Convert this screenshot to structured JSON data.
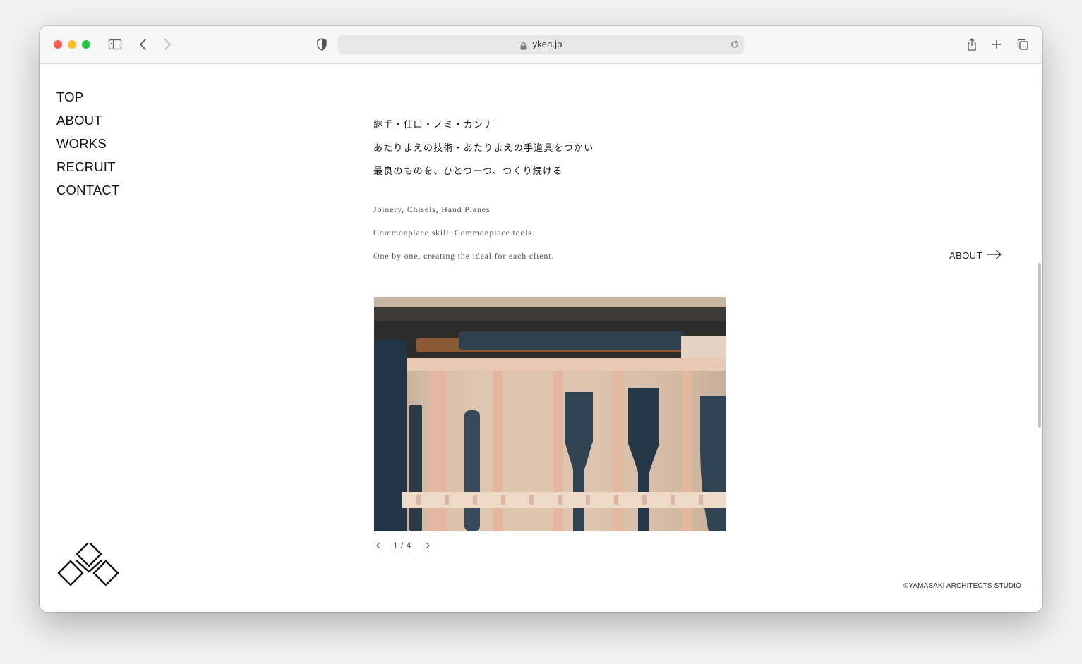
{
  "browser": {
    "url": "yken.jp",
    "traffic_lights": {
      "close": "#ff5f57",
      "minimize": "#febc2e",
      "zoom": "#28c840"
    }
  },
  "nav": {
    "items": [
      "TOP",
      "ABOUT",
      "WORKS",
      "RECRUIT",
      "CONTACT"
    ]
  },
  "intro": {
    "jp_lines": [
      "継手・仕口・ノミ・カンナ",
      "あたりまえの技術・あたりまえの手道具をつかい",
      "最良のものを、ひとつ一つ、つくり続ける"
    ],
    "en_lines": [
      "Joinery, Chisels, Hand Planes",
      "Commonplace skill. Commonplace tools.",
      "One by one, creating the ideal for each client."
    ],
    "about_link": "ABOUT"
  },
  "slideshow": {
    "counter": "1 / 4"
  },
  "footer": {
    "copyright": "©YAMASAKI ARCHITECTS STUDIO"
  },
  "icons": {
    "sidebar": "sidebar-icon",
    "back": "chevron-left-icon",
    "forward": "chevron-right-icon",
    "shield": "privacy-shield-icon",
    "share": "share-icon",
    "new_tab": "plus-icon",
    "tabs": "tabs-overview-icon"
  }
}
